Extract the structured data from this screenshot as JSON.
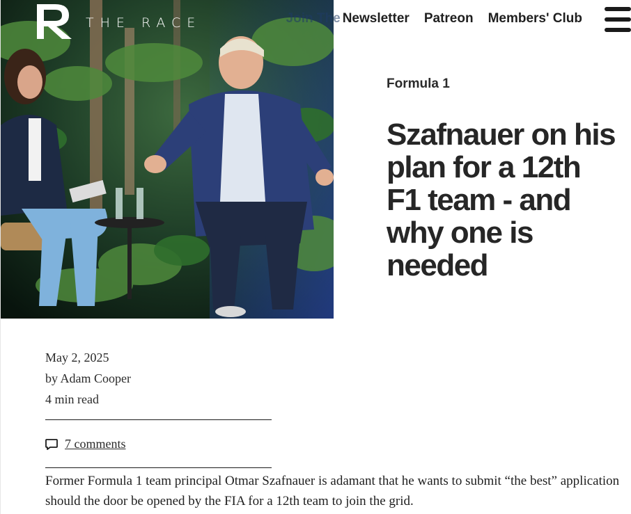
{
  "brand": {
    "name": "THE RACE",
    "mark": "R"
  },
  "nav": {
    "items": [
      {
        "label": "Join The",
        "faded": true
      },
      {
        "label": "Newsletter"
      },
      {
        "label": "Patreon"
      },
      {
        "label": "Members' Club"
      }
    ],
    "menu_icon": "hamburger-menu-icon"
  },
  "hero": {
    "alt": "Otmar Szafnauer speaking on stage in interview"
  },
  "article": {
    "category": "Formula 1",
    "headline": "Szafnauer on his plan for a 12th F1 team - and why one is needed",
    "date": "May 2, 2025",
    "author": "by Adam Cooper",
    "read_time": "4 min read",
    "comments": "7 comments",
    "intro": "Former Formula 1 team principal Otmar Szafnauer is adamant that he wants to submit “the best” application should the door be opened by the FIA for a 12th team to join the grid."
  },
  "colors": {
    "text": "#1a1a1a",
    "headline": "#262626",
    "background": "#ffffff"
  }
}
